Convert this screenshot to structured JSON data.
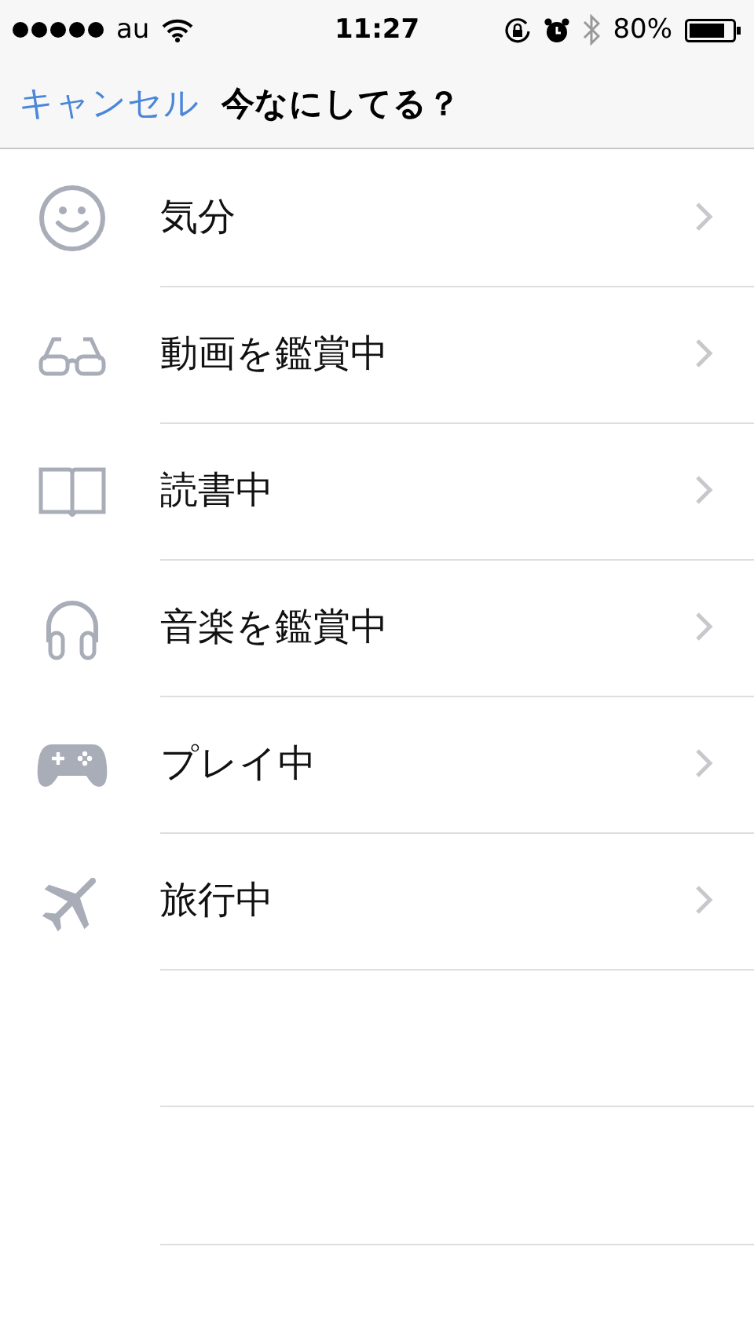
{
  "status_bar": {
    "carrier": "au",
    "time": "11:27",
    "battery": "80%"
  },
  "nav": {
    "cancel": "キャンセル",
    "title": "今なにしてる？"
  },
  "items": [
    {
      "kind": "mood",
      "label": "気分"
    },
    {
      "kind": "video",
      "label": "動画を鑑賞中"
    },
    {
      "kind": "book",
      "label": "読書中"
    },
    {
      "kind": "music",
      "label": "音楽を鑑賞中"
    },
    {
      "kind": "game",
      "label": "プレイ中"
    },
    {
      "kind": "travel",
      "label": "旅行中"
    }
  ]
}
